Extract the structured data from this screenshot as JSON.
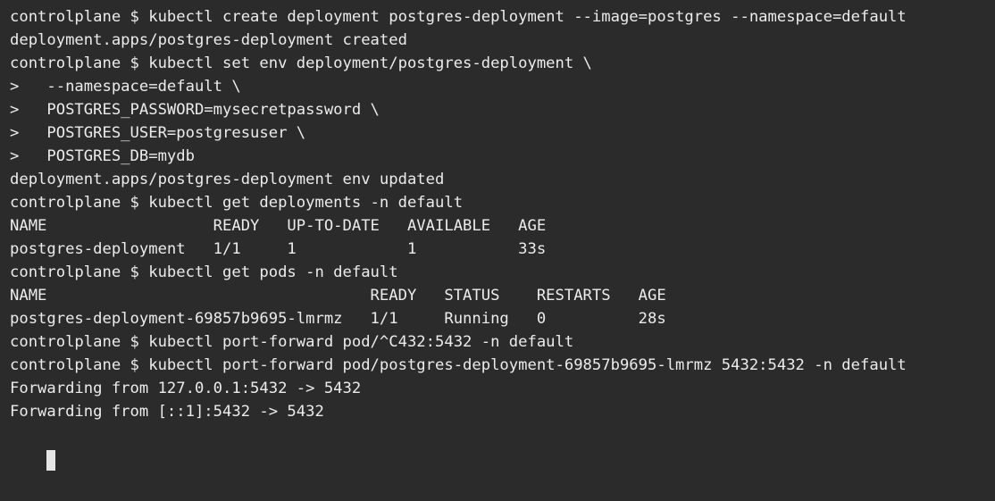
{
  "terminal": {
    "lines": [
      "controlplane $ kubectl create deployment postgres-deployment --image=postgres --namespace=default",
      "deployment.apps/postgres-deployment created",
      "controlplane $ kubectl set env deployment/postgres-deployment \\",
      ">   --namespace=default \\",
      ">   POSTGRES_PASSWORD=mysecretpassword \\",
      ">   POSTGRES_USER=postgresuser \\",
      ">   POSTGRES_DB=mydb",
      "deployment.apps/postgres-deployment env updated",
      "controlplane $ kubectl get deployments -n default",
      "NAME                  READY   UP-TO-DATE   AVAILABLE   AGE",
      "postgres-deployment   1/1     1            1           33s",
      "controlplane $ kubectl get pods -n default",
      "NAME                                   READY   STATUS    RESTARTS   AGE",
      "postgres-deployment-69857b9695-lmrmz   1/1     Running   0          28s",
      "controlplane $ kubectl port-forward pod/^C432:5432 -n default",
      "controlplane $ kubectl port-forward pod/postgres-deployment-69857b9695-lmrmz 5432:5432 -n default",
      "Forwarding from 127.0.0.1:5432 -> 5432",
      "Forwarding from [::1]:5432 -> 5432"
    ],
    "background_color": "#2b2b2b",
    "text_color": "#ececec"
  }
}
